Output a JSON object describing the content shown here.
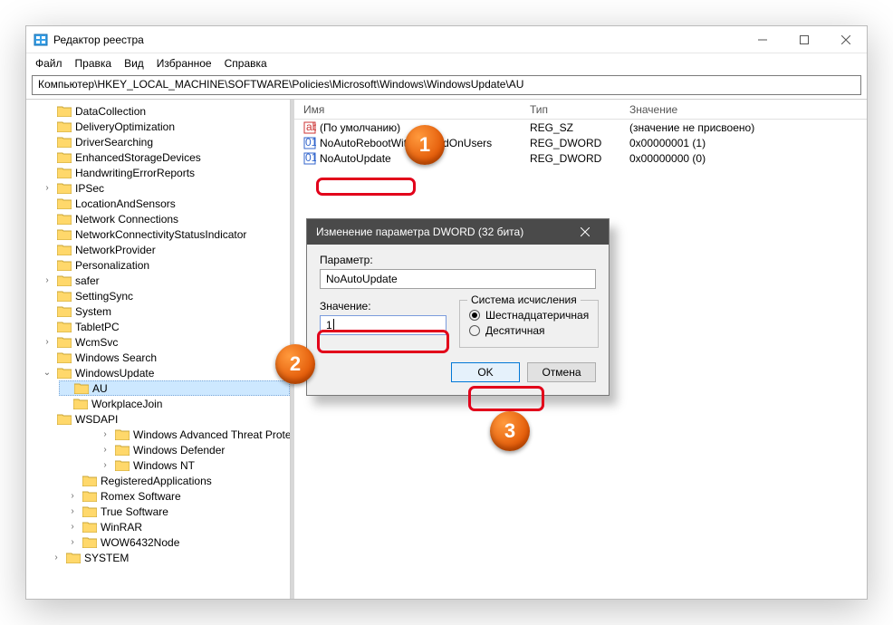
{
  "window": {
    "title": "Редактор реестра",
    "menu": [
      "Файл",
      "Правка",
      "Вид",
      "Избранное",
      "Справка"
    ],
    "address": "Компьютер\\HKEY_LOCAL_MACHINE\\SOFTWARE\\Policies\\Microsoft\\Windows\\WindowsUpdate\\AU"
  },
  "list": {
    "headers": {
      "name": "Имя",
      "type": "Тип",
      "value": "Значение"
    },
    "rows": [
      {
        "icon": "string",
        "name": "(По умолчанию)",
        "type": "REG_SZ",
        "value": "(значение не присвоено)"
      },
      {
        "icon": "dword",
        "name": "NoAutoRebootWithLoggedOnUsers",
        "type": "REG_DWORD",
        "value": "0x00000001 (1)"
      },
      {
        "icon": "dword",
        "name": "NoAutoUpdate",
        "type": "REG_DWORD",
        "value": "0x00000000 (0)"
      }
    ]
  },
  "tree": {
    "items": [
      {
        "l": "DataCollection",
        "e": ""
      },
      {
        "l": "DeliveryOptimization",
        "e": ""
      },
      {
        "l": "DriverSearching",
        "e": ""
      },
      {
        "l": "EnhancedStorageDevices",
        "e": ""
      },
      {
        "l": "HandwritingErrorReports",
        "e": ""
      },
      {
        "l": "IPSec",
        "e": ">"
      },
      {
        "l": "LocationAndSensors",
        "e": ""
      },
      {
        "l": "Network Connections",
        "e": ""
      },
      {
        "l": "NetworkConnectivityStatusIndicator",
        "e": ""
      },
      {
        "l": "NetworkProvider",
        "e": ""
      },
      {
        "l": "Personalization",
        "e": ""
      },
      {
        "l": "safer",
        "e": ">"
      },
      {
        "l": "SettingSync",
        "e": ""
      },
      {
        "l": "System",
        "e": ""
      },
      {
        "l": "TabletPC",
        "e": ""
      },
      {
        "l": "WcmSvc",
        "e": ">"
      },
      {
        "l": "Windows Search",
        "e": ""
      },
      {
        "l": "WindowsUpdate",
        "e": "v",
        "children": [
          {
            "l": "AU",
            "selected": true
          },
          {
            "l": "WorkplaceJoin"
          }
        ]
      },
      {
        "l": "WSDAPI",
        "e": ""
      }
    ],
    "siblingsL2": [
      {
        "l": "Windows Advanced Threat Protection",
        "e": ">"
      },
      {
        "l": "Windows Defender",
        "e": ">"
      },
      {
        "l": "Windows NT",
        "e": ">"
      }
    ],
    "siblingsL1": [
      {
        "l": "RegisteredApplications"
      },
      {
        "l": "Romex Software",
        "e": ">"
      },
      {
        "l": "True Software",
        "e": ">"
      },
      {
        "l": "WinRAR",
        "e": ">"
      },
      {
        "l": "WOW6432Node",
        "e": ">"
      }
    ],
    "root": [
      {
        "l": "SYSTEM",
        "e": ">"
      }
    ]
  },
  "dialog": {
    "title": "Изменение параметра DWORD (32 бита)",
    "param_label": "Параметр:",
    "param_value": "NoAutoUpdate",
    "value_label": "Значение:",
    "value_input": "1",
    "base_label": "Система исчисления",
    "radio_hex": "Шестнадцатеричная",
    "radio_dec": "Десятичная",
    "ok": "OK",
    "cancel": "Отмена"
  },
  "callouts": {
    "one": "1",
    "two": "2",
    "three": "3"
  }
}
